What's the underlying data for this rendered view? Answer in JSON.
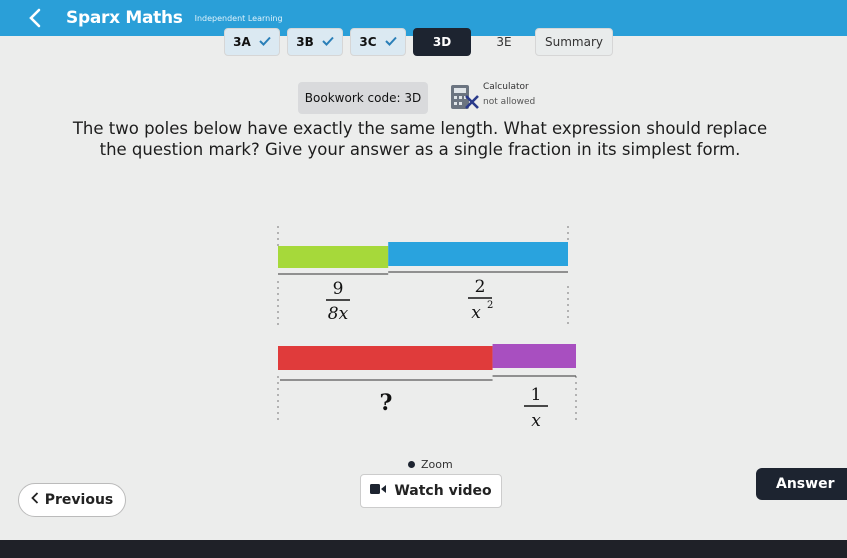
{
  "header": {
    "brand": "Sparx Maths",
    "subtitle": "Independent Learning"
  },
  "tabs": [
    {
      "label": "3A",
      "completed": true
    },
    {
      "label": "3B",
      "completed": true
    },
    {
      "label": "3C",
      "completed": true
    },
    {
      "label": "3D",
      "completed": false,
      "active": true
    },
    {
      "label": "3E",
      "completed": false
    },
    {
      "label": "Summary",
      "completed": false
    }
  ],
  "bookwork": {
    "label": "Bookwork code: 3D"
  },
  "calculator": {
    "title": "Calculator",
    "status": "not allowed"
  },
  "question": {
    "text": "The two poles below have exactly the same length. What expression should replace the question mark? Give your answer as a single fraction in its simplest form."
  },
  "diagram": {
    "pole1": {
      "left_label_num": "9",
      "left_label_den": "8x",
      "right_label_num": "2",
      "right_label_den_base": "x",
      "right_label_den_exp": "2",
      "left_color": "#a6d93a",
      "right_color": "#29a3de",
      "left_fraction": 0.38
    },
    "pole2": {
      "left_label": "?",
      "right_label_num": "1",
      "right_label_den": "x",
      "left_color": "#e03b3b",
      "right_color": "#a84fc0",
      "left_fraction": 0.72
    }
  },
  "zoom": {
    "label": "Zoom"
  },
  "buttons": {
    "previous": "Previous",
    "watch_video": "Watch video",
    "answer": "Answer"
  }
}
